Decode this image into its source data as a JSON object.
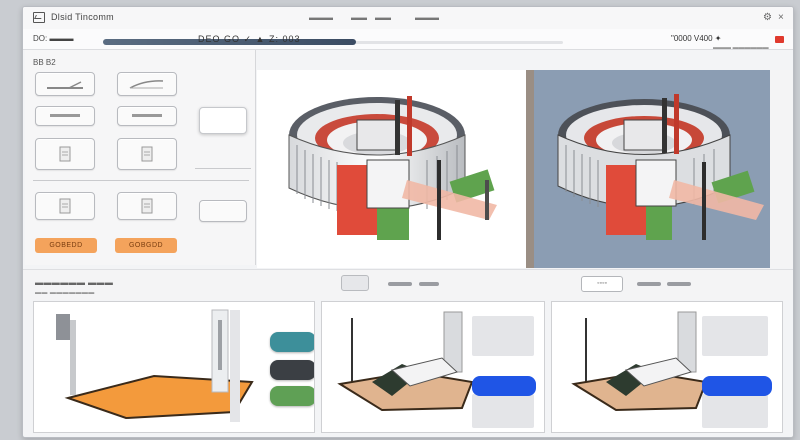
{
  "app": {
    "title": "Dlsid Tincomm",
    "logo_icon": "chart-icon",
    "menu": [
      "▬▬▬",
      "▬▬",
      "▬▬",
      "▬▬▬"
    ],
    "window_controls": [
      "⚙",
      "×"
    ]
  },
  "toolbar": {
    "field_label": "DO: ▬▬▬",
    "coords": "DEO GO  ✓ ▲ Z: 003",
    "progress_fraction": 0.55,
    "right_readout": "\"0000  V400 ✦",
    "right_sub": "▬▬▬  ▬▬▬▬▬▬",
    "accent_color": "#e03a2e"
  },
  "left_panel": {
    "label": "BB B2",
    "buttons": [
      {
        "name": "tool-line",
        "icon": "line-icon"
      },
      {
        "name": "tool-curve",
        "icon": "curve-icon"
      },
      {
        "name": "tool-rect-1",
        "icon": "dash-icon"
      },
      {
        "name": "tool-rect-2",
        "icon": "dash-icon"
      },
      {
        "name": "tool-doc-1",
        "icon": "doc-icon"
      },
      {
        "name": "tool-doc-2",
        "icon": "doc-icon"
      },
      {
        "name": "tool-doc-3",
        "icon": "doc-icon"
      },
      {
        "name": "tool-doc-4",
        "icon": "doc-icon"
      }
    ],
    "action_buttons": [
      "GOBEDD",
      "GOBGDD"
    ],
    "orange_color": "#f4a35c"
  },
  "viewports": {
    "left_bg": "#ffffff",
    "right_bg": "#8b9db3"
  },
  "midbar": {
    "label": "▬▬▬▬▬▬  ▬▬▬",
    "label2": "▬▬ ▬▬▬▬▬▬▬",
    "center_button": "",
    "right_button": "◦◦◦◦"
  },
  "bottom": {
    "swatches": [
      {
        "name": "teal-swatch",
        "color": "#3d8f9a"
      },
      {
        "name": "dark-swatch",
        "color": "#3b3f44"
      },
      {
        "name": "green-swatch",
        "color": "#5fa055"
      }
    ],
    "blue_accent": "#1f55e6",
    "orange_accent": "#f08a24"
  }
}
